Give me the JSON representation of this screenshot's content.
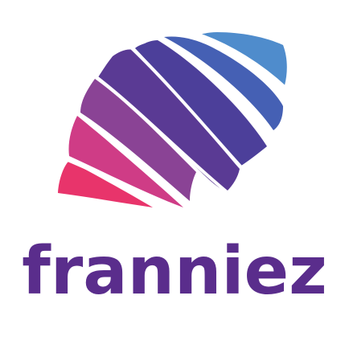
{
  "logo": {
    "wordmark": "franniez",
    "wordmark_color": "#5a2d8c",
    "stripe_colors": [
      "#e8346b",
      "#cf3c86",
      "#8a4395",
      "#5a3a94",
      "#4c3f9a",
      "#4560b4",
      "#4f8ccc"
    ],
    "icon": "striped-leaf-icon"
  }
}
